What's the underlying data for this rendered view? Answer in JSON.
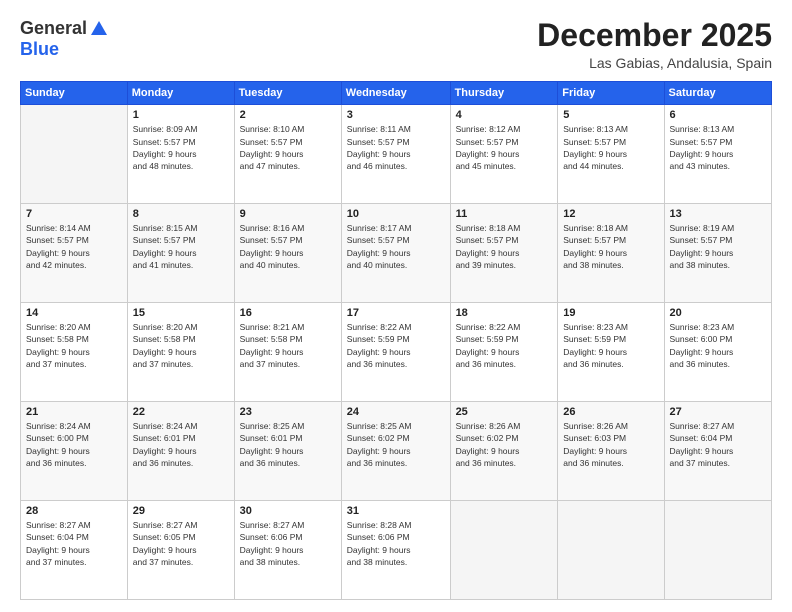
{
  "logo": {
    "general": "General",
    "blue": "Blue"
  },
  "header": {
    "month": "December 2025",
    "location": "Las Gabias, Andalusia, Spain"
  },
  "weekdays": [
    "Sunday",
    "Monday",
    "Tuesday",
    "Wednesday",
    "Thursday",
    "Friday",
    "Saturday"
  ],
  "weeks": [
    [
      {
        "day": "",
        "info": ""
      },
      {
        "day": "1",
        "info": "Sunrise: 8:09 AM\nSunset: 5:57 PM\nDaylight: 9 hours\nand 48 minutes."
      },
      {
        "day": "2",
        "info": "Sunrise: 8:10 AM\nSunset: 5:57 PM\nDaylight: 9 hours\nand 47 minutes."
      },
      {
        "day": "3",
        "info": "Sunrise: 8:11 AM\nSunset: 5:57 PM\nDaylight: 9 hours\nand 46 minutes."
      },
      {
        "day": "4",
        "info": "Sunrise: 8:12 AM\nSunset: 5:57 PM\nDaylight: 9 hours\nand 45 minutes."
      },
      {
        "day": "5",
        "info": "Sunrise: 8:13 AM\nSunset: 5:57 PM\nDaylight: 9 hours\nand 44 minutes."
      },
      {
        "day": "6",
        "info": "Sunrise: 8:13 AM\nSunset: 5:57 PM\nDaylight: 9 hours\nand 43 minutes."
      }
    ],
    [
      {
        "day": "7",
        "info": "Sunrise: 8:14 AM\nSunset: 5:57 PM\nDaylight: 9 hours\nand 42 minutes."
      },
      {
        "day": "8",
        "info": "Sunrise: 8:15 AM\nSunset: 5:57 PM\nDaylight: 9 hours\nand 41 minutes."
      },
      {
        "day": "9",
        "info": "Sunrise: 8:16 AM\nSunset: 5:57 PM\nDaylight: 9 hours\nand 40 minutes."
      },
      {
        "day": "10",
        "info": "Sunrise: 8:17 AM\nSunset: 5:57 PM\nDaylight: 9 hours\nand 40 minutes."
      },
      {
        "day": "11",
        "info": "Sunrise: 8:18 AM\nSunset: 5:57 PM\nDaylight: 9 hours\nand 39 minutes."
      },
      {
        "day": "12",
        "info": "Sunrise: 8:18 AM\nSunset: 5:57 PM\nDaylight: 9 hours\nand 38 minutes."
      },
      {
        "day": "13",
        "info": "Sunrise: 8:19 AM\nSunset: 5:57 PM\nDaylight: 9 hours\nand 38 minutes."
      }
    ],
    [
      {
        "day": "14",
        "info": "Sunrise: 8:20 AM\nSunset: 5:58 PM\nDaylight: 9 hours\nand 37 minutes."
      },
      {
        "day": "15",
        "info": "Sunrise: 8:20 AM\nSunset: 5:58 PM\nDaylight: 9 hours\nand 37 minutes."
      },
      {
        "day": "16",
        "info": "Sunrise: 8:21 AM\nSunset: 5:58 PM\nDaylight: 9 hours\nand 37 minutes."
      },
      {
        "day": "17",
        "info": "Sunrise: 8:22 AM\nSunset: 5:59 PM\nDaylight: 9 hours\nand 36 minutes."
      },
      {
        "day": "18",
        "info": "Sunrise: 8:22 AM\nSunset: 5:59 PM\nDaylight: 9 hours\nand 36 minutes."
      },
      {
        "day": "19",
        "info": "Sunrise: 8:23 AM\nSunset: 5:59 PM\nDaylight: 9 hours\nand 36 minutes."
      },
      {
        "day": "20",
        "info": "Sunrise: 8:23 AM\nSunset: 6:00 PM\nDaylight: 9 hours\nand 36 minutes."
      }
    ],
    [
      {
        "day": "21",
        "info": "Sunrise: 8:24 AM\nSunset: 6:00 PM\nDaylight: 9 hours\nand 36 minutes."
      },
      {
        "day": "22",
        "info": "Sunrise: 8:24 AM\nSunset: 6:01 PM\nDaylight: 9 hours\nand 36 minutes."
      },
      {
        "day": "23",
        "info": "Sunrise: 8:25 AM\nSunset: 6:01 PM\nDaylight: 9 hours\nand 36 minutes."
      },
      {
        "day": "24",
        "info": "Sunrise: 8:25 AM\nSunset: 6:02 PM\nDaylight: 9 hours\nand 36 minutes."
      },
      {
        "day": "25",
        "info": "Sunrise: 8:26 AM\nSunset: 6:02 PM\nDaylight: 9 hours\nand 36 minutes."
      },
      {
        "day": "26",
        "info": "Sunrise: 8:26 AM\nSunset: 6:03 PM\nDaylight: 9 hours\nand 36 minutes."
      },
      {
        "day": "27",
        "info": "Sunrise: 8:27 AM\nSunset: 6:04 PM\nDaylight: 9 hours\nand 37 minutes."
      }
    ],
    [
      {
        "day": "28",
        "info": "Sunrise: 8:27 AM\nSunset: 6:04 PM\nDaylight: 9 hours\nand 37 minutes."
      },
      {
        "day": "29",
        "info": "Sunrise: 8:27 AM\nSunset: 6:05 PM\nDaylight: 9 hours\nand 37 minutes."
      },
      {
        "day": "30",
        "info": "Sunrise: 8:27 AM\nSunset: 6:06 PM\nDaylight: 9 hours\nand 38 minutes."
      },
      {
        "day": "31",
        "info": "Sunrise: 8:28 AM\nSunset: 6:06 PM\nDaylight: 9 hours\nand 38 minutes."
      },
      {
        "day": "",
        "info": ""
      },
      {
        "day": "",
        "info": ""
      },
      {
        "day": "",
        "info": ""
      }
    ]
  ]
}
